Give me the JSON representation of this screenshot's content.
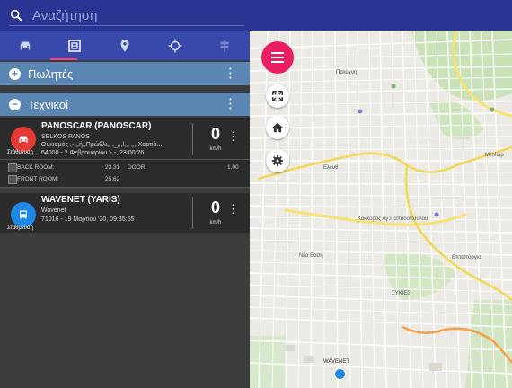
{
  "search": {
    "placeholder": "Αναζήτηση"
  },
  "tabs": [
    {
      "icon": "car-icon"
    },
    {
      "icon": "report-icon",
      "active": true
    },
    {
      "icon": "place-icon"
    },
    {
      "icon": "crosshair-icon"
    },
    {
      "icon": "road-sign-icon"
    }
  ],
  "groups": [
    {
      "label": "Πωλητές",
      "toggle": "+"
    },
    {
      "label": "Τεχνικοί",
      "toggle": "−"
    }
  ],
  "vehicles": [
    {
      "name": "PANOSCAR (PANOSCAR)",
      "driver": "SELKOS PANOS",
      "address": "Ουκισμός ,-,,,ή,,Πρώθλι,, ,_,,,l,,, ,,, Χορτιά...",
      "datetime": "64000 - 2 Φεβρουαρίου '-,-, 23:00:26",
      "status": "Στάθμευση",
      "speed": "0",
      "unit": "km/h",
      "color": "#e53935",
      "sensors": [
        {
          "label": "BACK ROOM:",
          "value": "23.31"
        },
        {
          "label": "DOOR:",
          "value": "1.00"
        },
        {
          "label": "FRONT ROOM:",
          "value": "25.62"
        }
      ]
    },
    {
      "name": "WAVENET (YARIS)",
      "driver": "Wavenet",
      "datetime": "71016 - 19 Μαρτίου '20, 09:35:55",
      "status": "Στάθμευση",
      "speed": "0",
      "unit": "km/h",
      "color": "#1e88e5"
    }
  ],
  "map": {
    "labels": {
      "poliki": "Πολύχνη",
      "metsovo": "Μετέωρ",
      "eleftheria": "Ελευθ",
      "kokkoros": "Κοκκόρος Αγ.Παπαδοπούλου",
      "epta": "Επταπύργιο",
      "vilia": "Νέα Βαση",
      "sykies": "ΣΥΚΙΕΣ",
      "wavenet": "WAVENET"
    }
  },
  "colors": {
    "topbar": "#283593",
    "tabs": "#3949ab",
    "group": "#5b86b3",
    "fab": "#e91e63",
    "tab_indicator": "#ff4081"
  }
}
